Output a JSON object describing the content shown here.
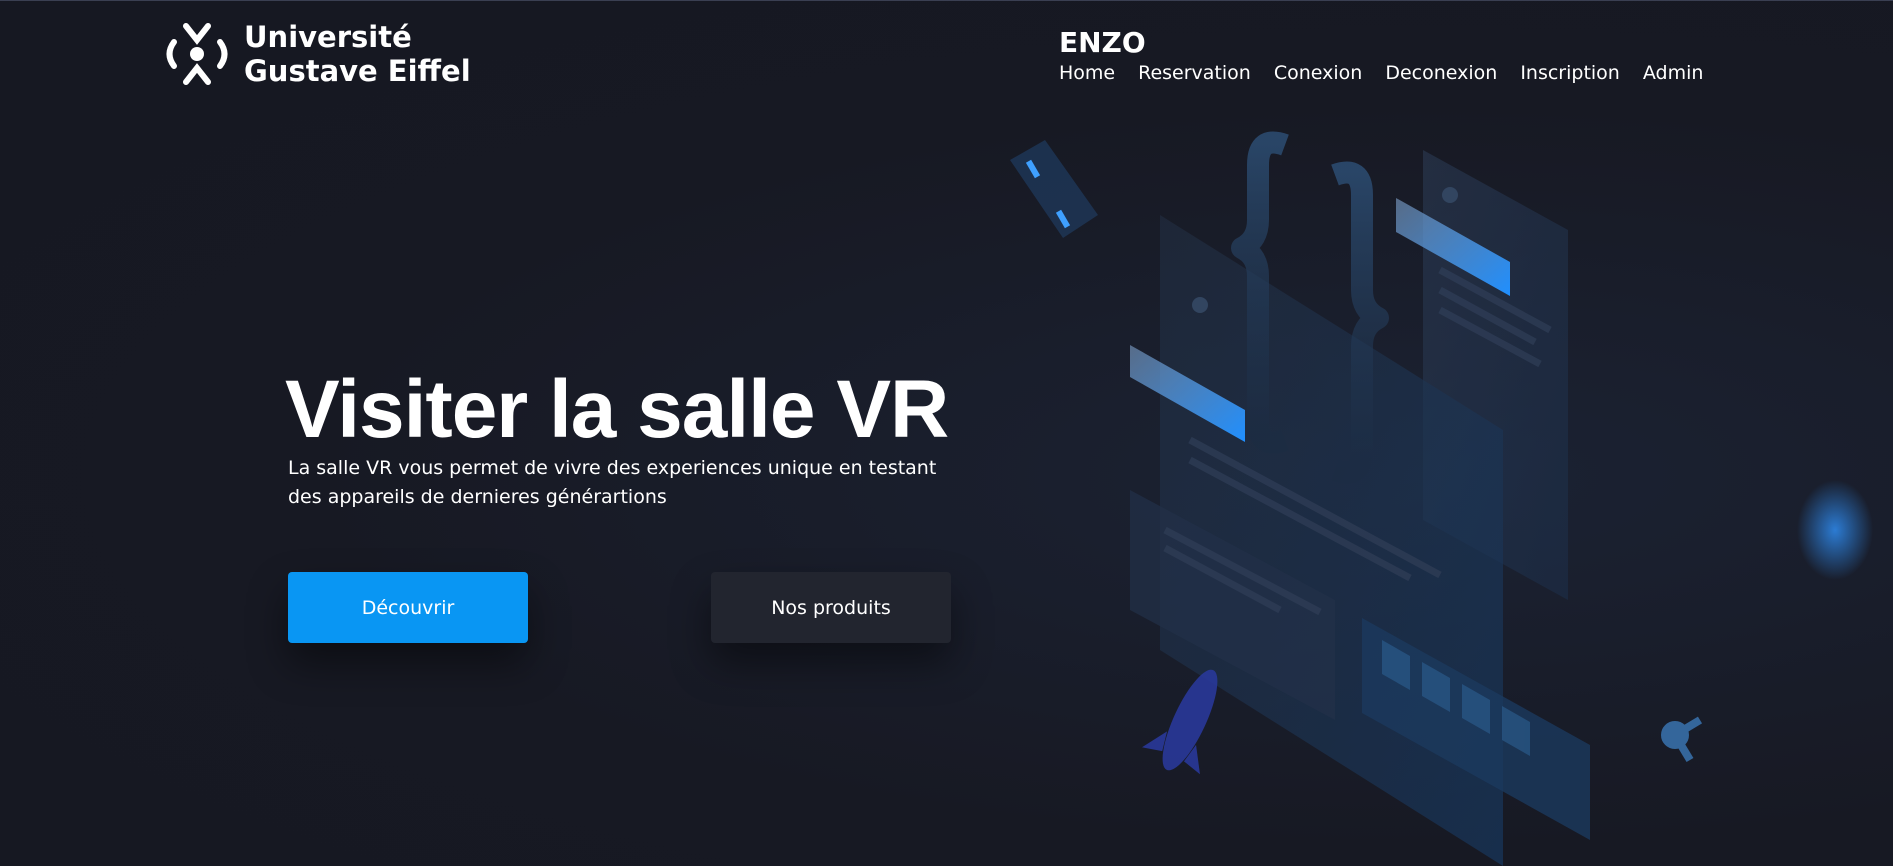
{
  "logo": {
    "line1": "Université",
    "line2": "Gustave Eiffel",
    "icon": "university-logo-icon"
  },
  "header": {
    "brand": "ENZO",
    "nav": [
      {
        "label": "Home"
      },
      {
        "label": "Reservation"
      },
      {
        "label": "Conexion"
      },
      {
        "label": "Deconexion"
      },
      {
        "label": "Inscription"
      },
      {
        "label": "Admin"
      }
    ]
  },
  "hero": {
    "title": "Visiter la salle VR",
    "subtitle": "La salle VR vous permet de vivre des experiences unique en testant des appareils de dernieres générartions",
    "primary_button": "Découvrir",
    "secondary_button": "Nos produits",
    "illustration_icon": "isometric-code-illustration-icon"
  },
  "colors": {
    "background": "#171923",
    "primary": "#0996f3",
    "secondary_button": "#22252f",
    "text": "#ffffff"
  }
}
